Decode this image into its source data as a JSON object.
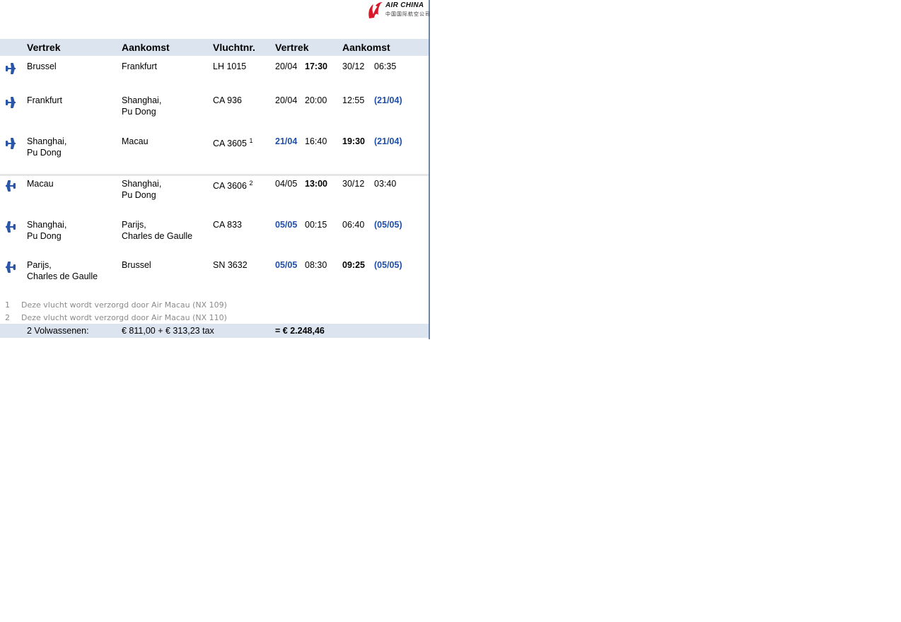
{
  "logo": {
    "name": "AIR CHINA",
    "chinese": "中国国际航空公司",
    "brand_color": "#d7192a"
  },
  "headers": {
    "vertrek": "Vertrek",
    "aankomst": "Aankomst",
    "vluchtnr": "Vluchtnr.",
    "dep_time": "Vertrek",
    "arr_time": "Aankomst"
  },
  "segments": [
    {
      "direction": "outbound-plane-icon",
      "from_1": "Brussel",
      "from_2": "",
      "to_1": "Frankfurt",
      "to_2": "",
      "flight": "LH 1015",
      "footnote_ref": "",
      "dep_date": "20/04",
      "dep_time": "17:30",
      "arr_date": "30/12",
      "arr_time": "06:35"
    },
    {
      "direction": "outbound-plane-icon",
      "from_1": "Frankfurt",
      "from_2": "",
      "to_1": "Shanghai,",
      "to_2": "Pu Dong",
      "flight": "CA 936",
      "footnote_ref": "",
      "dep_date": "20/04",
      "dep_time": "20:00",
      "arr_date": "12:55",
      "arr_time": "(21/04)"
    },
    {
      "direction": "outbound-plane-icon",
      "from_1": "Shanghai,",
      "from_2": "Pu Dong",
      "to_1": "Macau",
      "to_2": "",
      "flight": "CA 3605",
      "footnote_ref": "1",
      "dep_date": "21/04",
      "dep_time": "16:40",
      "arr_date": "19:30",
      "arr_time": "(21/04)"
    },
    {
      "direction": "return-plane-icon",
      "from_1": "Macau",
      "from_2": "",
      "to_1": "Shanghai,",
      "to_2": "Pu Dong",
      "flight": "CA 3606",
      "footnote_ref": "2",
      "dep_date": "04/05",
      "dep_time": "13:00",
      "arr_date": "30/12",
      "arr_time": "03:40"
    },
    {
      "direction": "return-plane-icon",
      "from_1": "Shanghai,",
      "from_2": "Pu Dong",
      "to_1": "Parijs,",
      "to_2": "Charles de Gaulle",
      "flight": "CA 833",
      "footnote_ref": "",
      "dep_date": "05/05",
      "dep_time": "00:15",
      "arr_date": "06:40",
      "arr_time": "(05/05)"
    },
    {
      "direction": "return-plane-icon",
      "from_1": "Parijs,",
      "from_2": "Charles de Gaulle",
      "to_1": "Brussel",
      "to_2": "",
      "flight": "SN 3632",
      "footnote_ref": "",
      "dep_date": "05/05",
      "dep_time": "08:30",
      "arr_date": "09:25",
      "arr_time": "(05/05)"
    }
  ],
  "footnotes": [
    {
      "num": "1",
      "text": "Deze vlucht wordt verzorgd door Air Macau (NX 109)"
    },
    {
      "num": "2",
      "text": "Deze vlucht wordt verzorgd door Air Macau (NX 110)"
    }
  ],
  "total": {
    "passengers": "2 Volwassenen:",
    "breakdown": "€ 811,00 + € 313,23 tax",
    "sum": "= € 2.248,46"
  },
  "colors": {
    "header_bg": "#dce4f0",
    "accent_blue": "#1f4fa8",
    "icon_blue": "#2a56a8",
    "footnote_gray": "#8a8a8a"
  }
}
